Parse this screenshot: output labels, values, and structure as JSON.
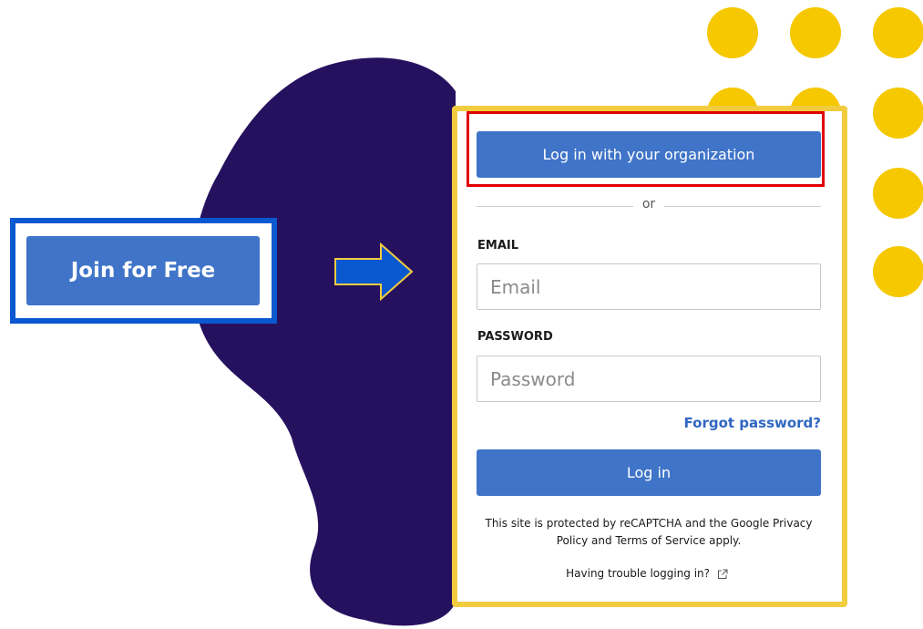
{
  "decor": {
    "blob_color": "#26115f",
    "dot_color": "#f5c800"
  },
  "join": {
    "button_label": "Join for Free",
    "highlight_color": "#0a58d0"
  },
  "arrow": {
    "icon": "right-arrow-icon",
    "fill_color": "#0a58d0",
    "stroke_color": "#f2cc3f"
  },
  "login_card": {
    "border_color": "#f2cc3f",
    "org_button_label": "Log in with your organization",
    "org_highlight_color": "#e00000",
    "divider_text": "or",
    "email": {
      "label": "EMAIL",
      "placeholder": "Email",
      "value": ""
    },
    "password": {
      "label": "PASSWORD",
      "placeholder": "Password",
      "value": ""
    },
    "forgot_password_label": "Forgot password?",
    "login_button_label": "Log in",
    "recaptcha_text": "This site is protected by reCAPTCHA and the Google Privacy Policy and Terms of Service apply.",
    "trouble_text": "Having trouble logging in?",
    "trouble_icon": "external-link-icon",
    "accent_color": "#3f74c8",
    "link_color": "#2f67c2"
  }
}
